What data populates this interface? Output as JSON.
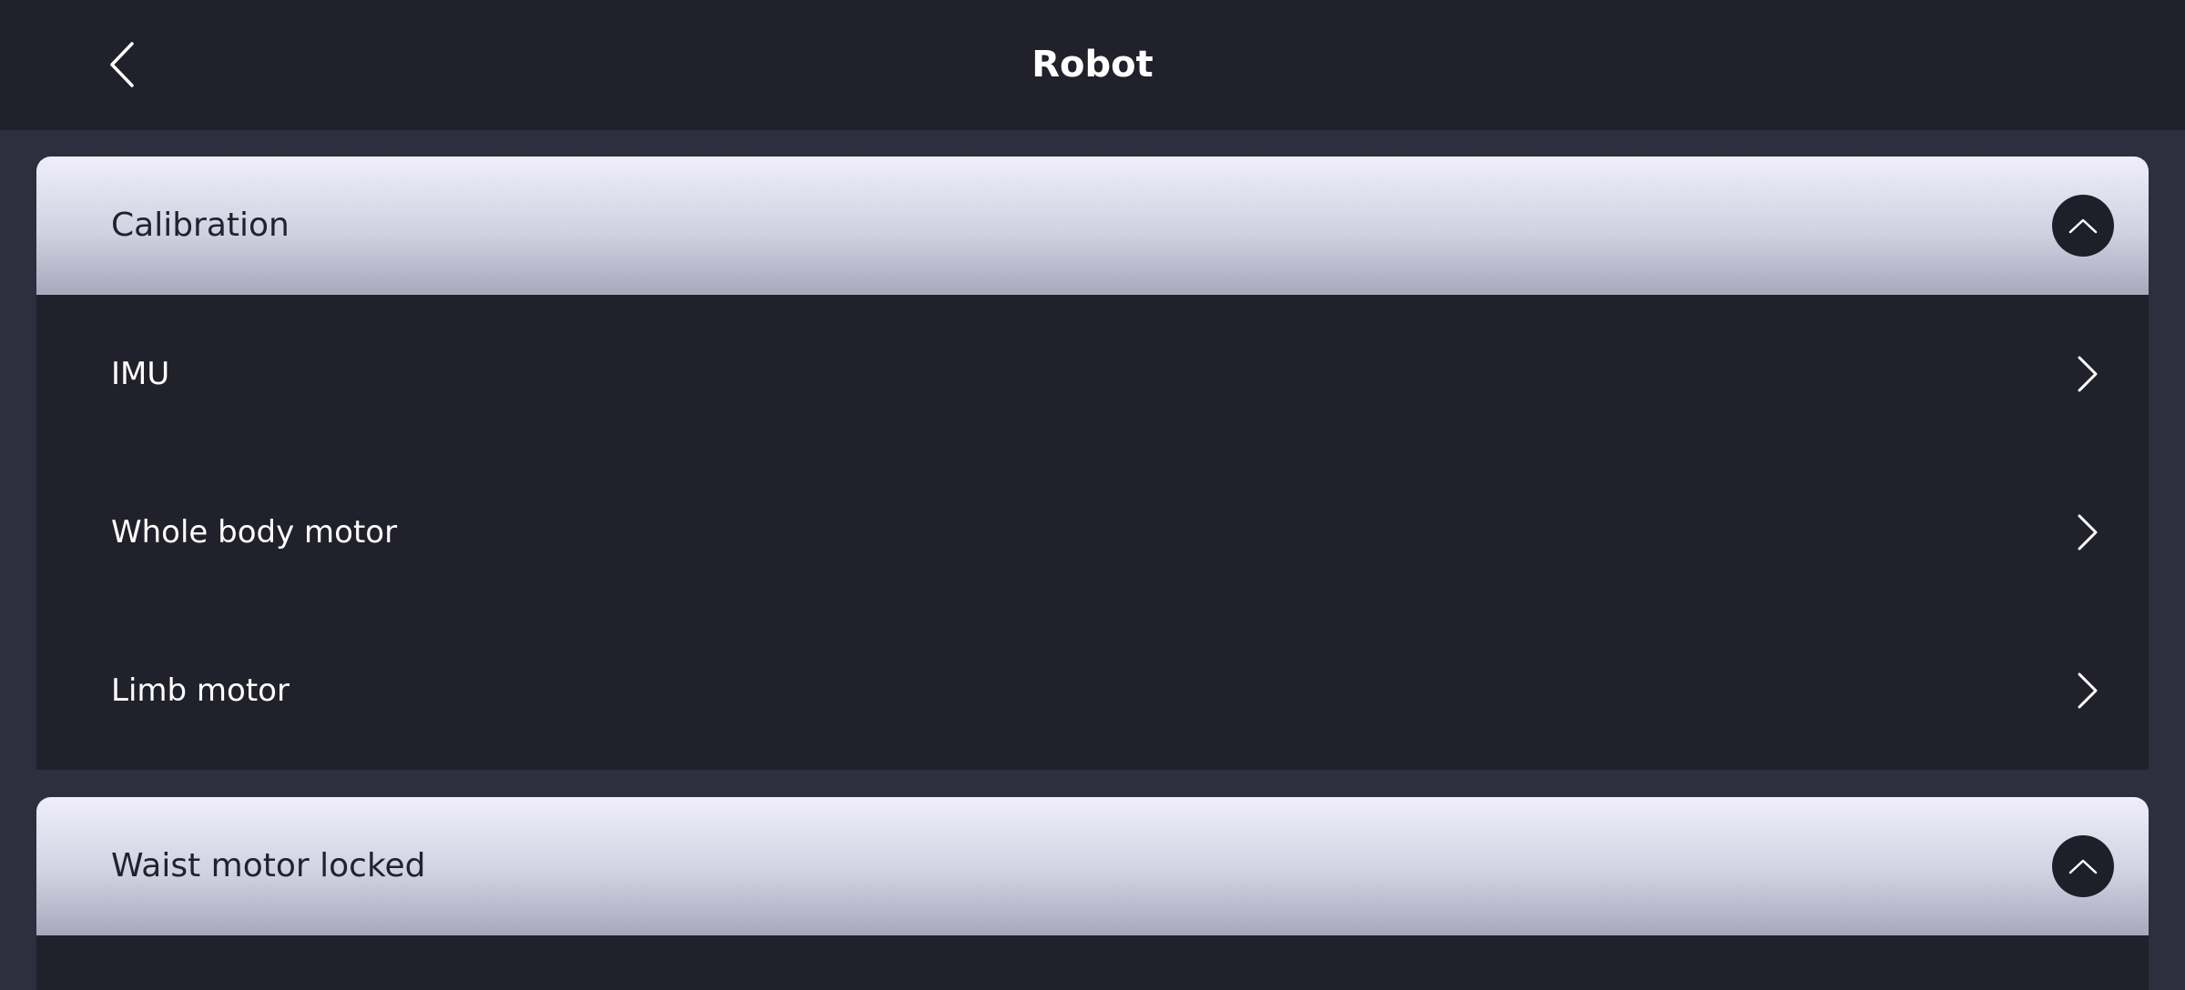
{
  "header": {
    "title": "Robot",
    "back_icon": "chevron-left-icon"
  },
  "sections": [
    {
      "title": "Calibration",
      "expanded": true,
      "toggle_icon": "chevron-up-icon",
      "items": [
        {
          "label": "IMU",
          "icon": "chevron-right-icon"
        },
        {
          "label": "Whole body motor",
          "icon": "chevron-right-icon"
        },
        {
          "label": "Limb motor",
          "icon": "chevron-right-icon"
        }
      ]
    },
    {
      "title": "Waist motor locked",
      "expanded": true,
      "toggle_icon": "chevron-up-icon",
      "items": []
    }
  ],
  "colors": {
    "background": "#2e2e3e",
    "panel": "#21212c",
    "header_gradient_top": "#efeefa",
    "header_gradient_bottom": "#a8a8bd",
    "text_light": "#ffffff",
    "text_dark": "#22222e"
  }
}
